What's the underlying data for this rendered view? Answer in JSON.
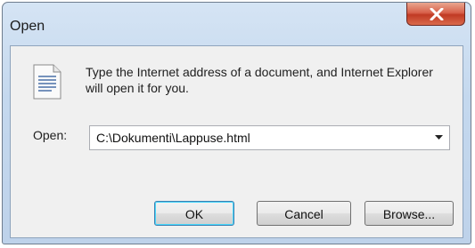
{
  "window": {
    "title": "Open",
    "close_icon": "close-x-icon"
  },
  "message": {
    "icon": "document-icon",
    "text": "Type the Internet address of a document, and Internet Explorer will open it for you."
  },
  "open_field": {
    "label": "Open:",
    "value": "C:\\Dokumenti\\Lappuse.html",
    "dropdown_icon": "chevron-down-icon"
  },
  "buttons": {
    "ok": "OK",
    "cancel": "Cancel",
    "browse": "Browse..."
  }
}
